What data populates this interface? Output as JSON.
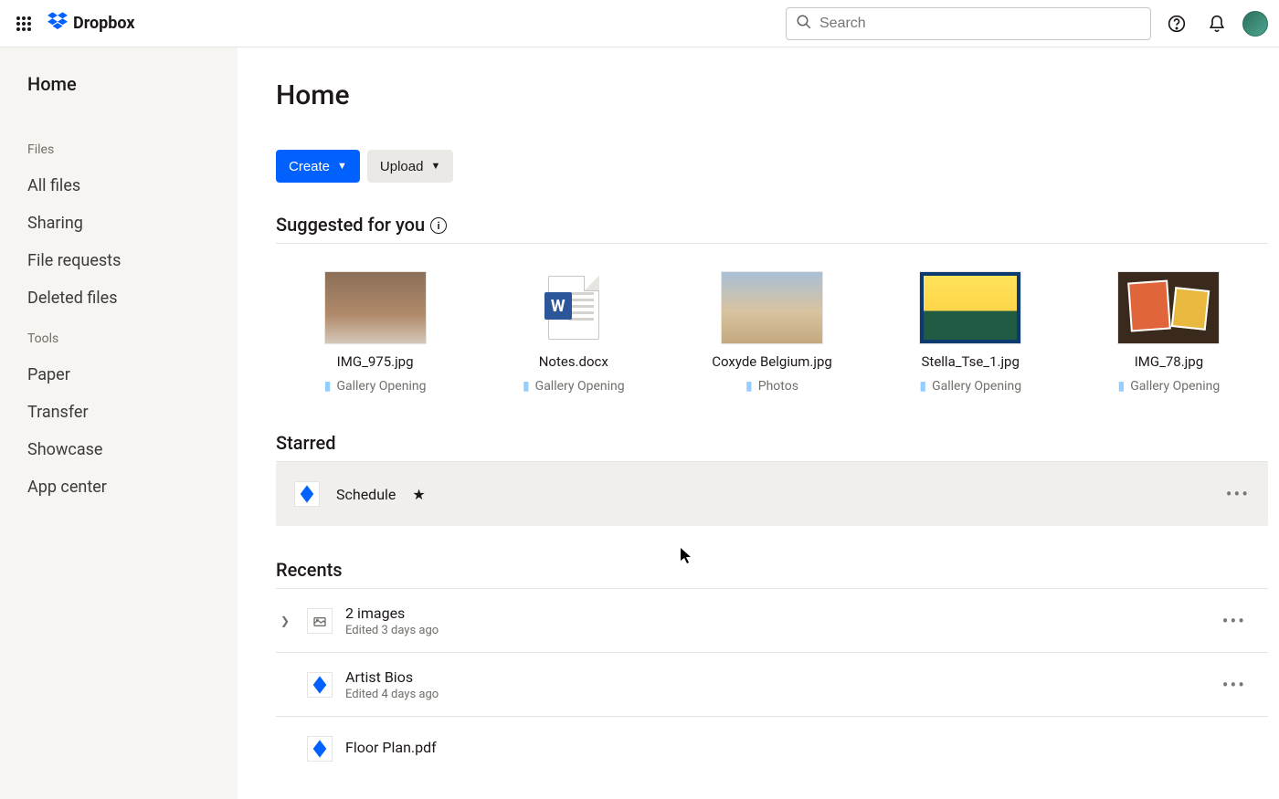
{
  "header": {
    "brand": "Dropbox",
    "search_placeholder": "Search"
  },
  "sidebar": {
    "home": "Home",
    "files_label": "Files",
    "files": [
      "All files",
      "Sharing",
      "File requests",
      "Deleted files"
    ],
    "tools_label": "Tools",
    "tools": [
      "Paper",
      "Transfer",
      "Showcase",
      "App center"
    ]
  },
  "main": {
    "title": "Home",
    "create_label": "Create",
    "upload_label": "Upload",
    "suggested_heading": "Suggested for you",
    "starred_heading": "Starred",
    "recents_heading": "Recents"
  },
  "suggested": [
    {
      "name": "IMG_975.jpg",
      "folder": "Gallery Opening"
    },
    {
      "name": "Notes.docx",
      "folder": "Gallery Opening"
    },
    {
      "name": "Coxyde Belgium.jpg",
      "folder": "Photos"
    },
    {
      "name": "Stella_Tse_1.jpg",
      "folder": "Gallery Opening"
    },
    {
      "name": "IMG_78.jpg",
      "folder": "Gallery Opening"
    }
  ],
  "starred": [
    {
      "name": "Schedule"
    }
  ],
  "recents": [
    {
      "name": "2 images",
      "meta": "Edited 3 days ago",
      "expandable": true,
      "icon": "image-stack"
    },
    {
      "name": "Artist Bios",
      "meta": "Edited 4 days ago",
      "expandable": false,
      "icon": "paper"
    },
    {
      "name": "Floor Plan.pdf",
      "meta": "",
      "expandable": false,
      "icon": "paper"
    }
  ]
}
